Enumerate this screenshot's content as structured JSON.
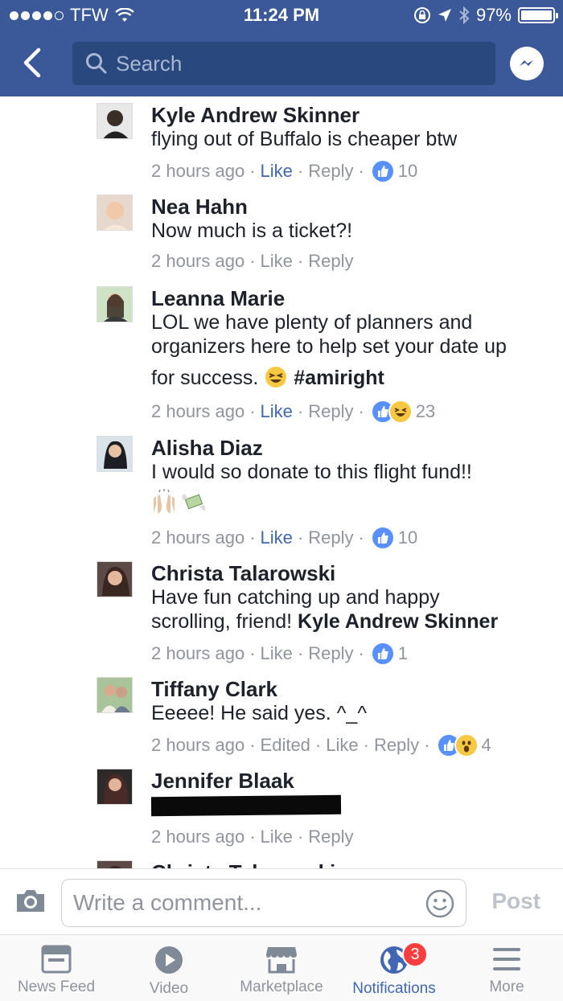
{
  "status_bar": {
    "carrier": "TFW",
    "time": "11:24 PM",
    "battery": "97%"
  },
  "nav": {
    "search_placeholder": "Search"
  },
  "comments": [
    {
      "name": "Kyle Andrew Skinner",
      "text": "flying out of Buffalo is cheaper btw",
      "time": "2 hours ago",
      "like": "Like",
      "reply": "Reply",
      "reactions": "10"
    },
    {
      "name": "Nea Hahn",
      "text": "Now much is a ticket?!",
      "time": "2 hours ago",
      "like": "Like",
      "reply": "Reply"
    },
    {
      "name": "Leanna Marie",
      "text_line1": "LOL we have plenty of planners and",
      "text_line2": "organizers here to help set your date up",
      "text_line3a": "for success.",
      "hashtag": "#amiright",
      "time": "2 hours ago",
      "like": "Like",
      "reply": "Reply",
      "reactions": "23"
    },
    {
      "name": "Alisha Diaz",
      "text": "I would so donate to this flight fund!!",
      "time": "2 hours ago",
      "like": "Like",
      "reply": "Reply",
      "reactions": "10"
    },
    {
      "name": "Christa Talarowski",
      "text_line1": "Have fun catching up and happy",
      "text_line2a": "scrolling, friend!",
      "mention": "Kyle Andrew Skinner",
      "time": "2 hours ago",
      "like": "Like",
      "reply": "Reply",
      "reactions": "1"
    },
    {
      "name": "Tiffany Clark",
      "text": "Eeeee! He said yes. ^_^",
      "time": "2 hours ago",
      "edited": "Edited",
      "like": "Like",
      "reply": "Reply",
      "reactions": "4"
    },
    {
      "name": "Jennifer Blaak",
      "time": "2 hours ago",
      "like": "Like",
      "reply": "Reply"
    },
    {
      "name": "Christa Talarowski"
    }
  ],
  "composer": {
    "placeholder": "Write a comment...",
    "post": "Post"
  },
  "tabs": [
    {
      "label": "News Feed"
    },
    {
      "label": "Video"
    },
    {
      "label": "Marketplace"
    },
    {
      "label": "Notifications",
      "badge": "3"
    },
    {
      "label": "More"
    }
  ],
  "colors": {
    "brand": "#3b5998",
    "link": "#4267b2",
    "muted": "#90949c",
    "badge": "#fa3e3e"
  }
}
